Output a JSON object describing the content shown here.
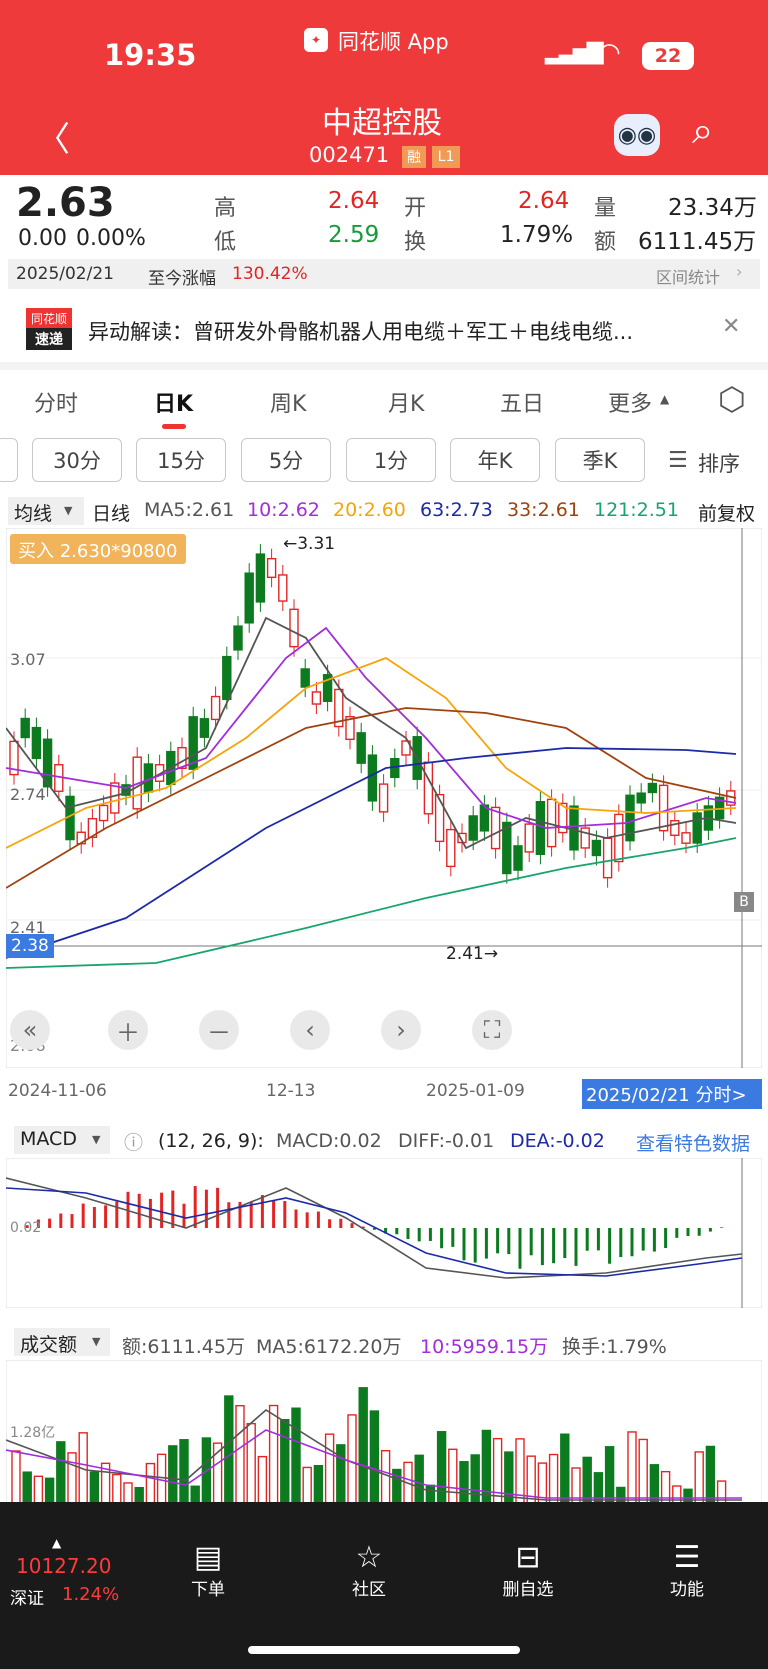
{
  "status": {
    "time": "19:35",
    "app": "同花顺 App",
    "battery": "22"
  },
  "header": {
    "name": "中超控股",
    "code": "002471",
    "tag1": "融",
    "tag2": "L1"
  },
  "quote": {
    "price": "2.63",
    "change": "0.00",
    "pct": "0.00%",
    "high_lbl": "高",
    "high": "2.64",
    "low_lbl": "低",
    "low": "2.59",
    "open_lbl": "开",
    "open": "2.64",
    "turn_lbl": "换",
    "turn": "1.79%",
    "vol_lbl": "量",
    "vol": "23.34万",
    "amt_lbl": "额",
    "amt": "6111.45万",
    "date": "2025/02/21",
    "since_lbl": "至今涨幅",
    "since": "130.42%",
    "stat": "区间统计"
  },
  "news": {
    "logo1": "同花顺",
    "logo2": "速递",
    "text": "异动解读：曾研发外骨骼机器人用电缆＋军工＋电线电缆..."
  },
  "tabs": [
    "分时",
    "日K",
    "周K",
    "月K",
    "五日",
    "更多"
  ],
  "periods": [
    "30分",
    "15分",
    "5分",
    "1分",
    "年K",
    "季K"
  ],
  "sort": "排序",
  "ma": {
    "type": "均线",
    "period": "日线",
    "ma5": "MA5:2.61",
    "ma10": "10:2.62",
    "ma20": "20:2.60",
    "ma63": "63:2.73",
    "ma33": "33:2.61",
    "ma121": "121:2.51",
    "adj": "前复权"
  },
  "chart": {
    "buy": "买入 2.630*90800",
    "high_mark": "←3.31",
    "low_mark": "2.41→",
    "price_tag": "2.38",
    "y1": "3.07",
    "y2": "2.74",
    "y3": "2.41",
    "y4": "2.08",
    "x1": "2024-11-06",
    "x2": "12-13",
    "x3": "2025-01-09",
    "date_btn": "2025/02/21 分时>",
    "b_mark": "B"
  },
  "macd": {
    "name": "MACD",
    "params": "(12, 26, 9):",
    "macd": "MACD:0.02",
    "diff": "DIFF:-0.01",
    "dea": "DEA:-0.02",
    "link": "查看特色数据",
    "y": "0.02"
  },
  "volume": {
    "name": "成交额",
    "amt": "额:6111.45万",
    "ma5": "MA5:6172.20万",
    "ma10": "10:5959.15万",
    "turn": "换手:1.79%",
    "y": "1.28亿"
  },
  "bottom": {
    "index_val": "10127.20",
    "index_name": "深证",
    "index_pct": "1.24%",
    "nav": [
      "下单",
      "社区",
      "删自选",
      "功能"
    ]
  },
  "chart_data": {
    "type": "candlestick",
    "series": [
      {
        "name": "MA5",
        "value": 2.61
      },
      {
        "name": "MA10",
        "value": 2.62
      },
      {
        "name": "MA20",
        "value": 2.6
      },
      {
        "name": "MA63",
        "value": 2.73
      },
      {
        "name": "MA33",
        "value": 2.61
      },
      {
        "name": "MA121",
        "value": 2.51
      }
    ],
    "ylabels": [
      3.07,
      2.74,
      2.41,
      2.08
    ],
    "xlabels": [
      "2024-11-06",
      "12-13",
      "2025-01-09"
    ],
    "high": 3.31,
    "low": 2.41,
    "last": 2.63
  }
}
